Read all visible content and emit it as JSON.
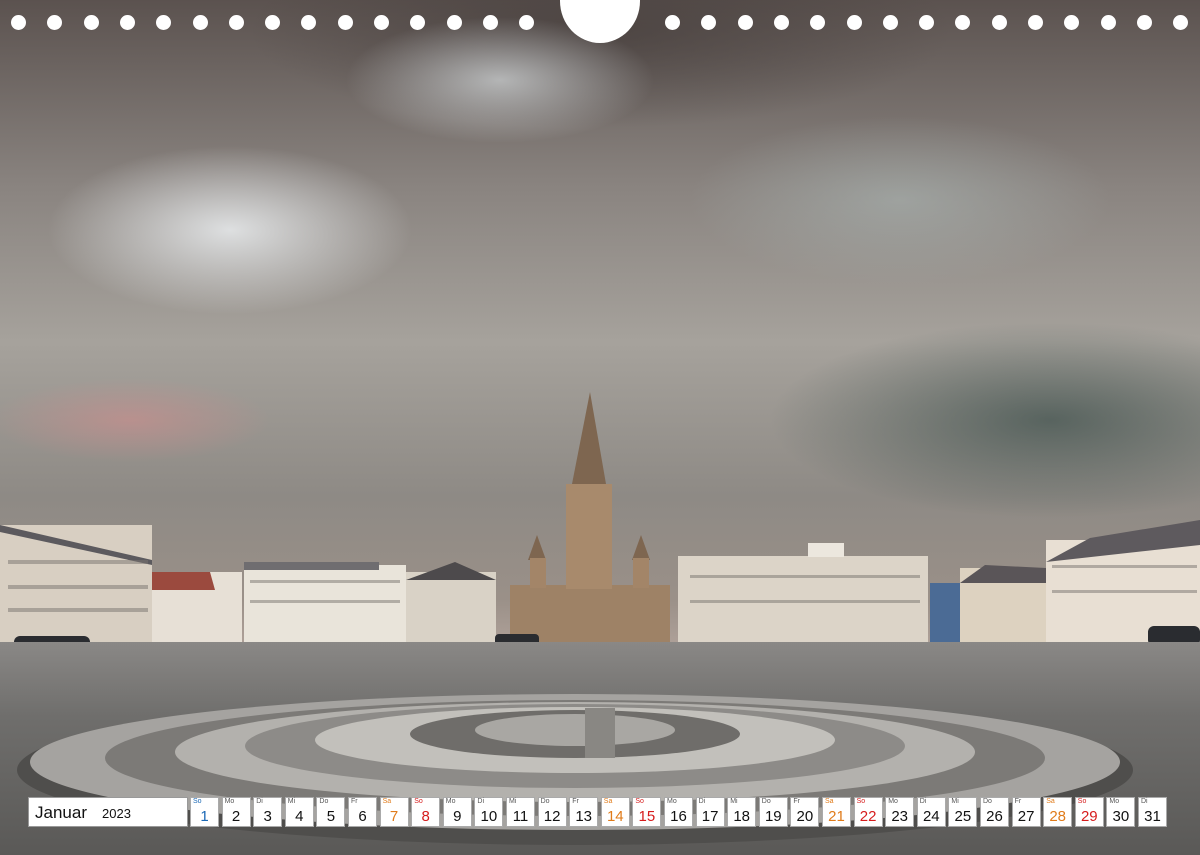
{
  "calendar": {
    "month": "Januar",
    "year": "2023",
    "days": [
      {
        "num": "1",
        "dow": "So",
        "type": "first"
      },
      {
        "num": "2",
        "dow": "Mo",
        "type": "weekday"
      },
      {
        "num": "3",
        "dow": "Di",
        "type": "weekday"
      },
      {
        "num": "4",
        "dow": "Mi",
        "type": "weekday"
      },
      {
        "num": "5",
        "dow": "Do",
        "type": "weekday"
      },
      {
        "num": "6",
        "dow": "Fr",
        "type": "weekday"
      },
      {
        "num": "7",
        "dow": "Sa",
        "type": "sat"
      },
      {
        "num": "8",
        "dow": "So",
        "type": "sun"
      },
      {
        "num": "9",
        "dow": "Mo",
        "type": "weekday"
      },
      {
        "num": "10",
        "dow": "Di",
        "type": "weekday"
      },
      {
        "num": "11",
        "dow": "Mi",
        "type": "weekday"
      },
      {
        "num": "12",
        "dow": "Do",
        "type": "weekday"
      },
      {
        "num": "13",
        "dow": "Fr",
        "type": "weekday"
      },
      {
        "num": "14",
        "dow": "Sa",
        "type": "sat"
      },
      {
        "num": "15",
        "dow": "So",
        "type": "sun"
      },
      {
        "num": "16",
        "dow": "Mo",
        "type": "weekday"
      },
      {
        "num": "17",
        "dow": "Di",
        "type": "weekday"
      },
      {
        "num": "18",
        "dow": "Mi",
        "type": "weekday"
      },
      {
        "num": "19",
        "dow": "Do",
        "type": "weekday"
      },
      {
        "num": "20",
        "dow": "Fr",
        "type": "weekday"
      },
      {
        "num": "21",
        "dow": "Sa",
        "type": "sat"
      },
      {
        "num": "22",
        "dow": "So",
        "type": "sun"
      },
      {
        "num": "23",
        "dow": "Mo",
        "type": "weekday"
      },
      {
        "num": "24",
        "dow": "Di",
        "type": "weekday"
      },
      {
        "num": "25",
        "dow": "Mi",
        "type": "weekday"
      },
      {
        "num": "26",
        "dow": "Do",
        "type": "weekday"
      },
      {
        "num": "27",
        "dow": "Fr",
        "type": "weekday"
      },
      {
        "num": "28",
        "dow": "Sa",
        "type": "sat"
      },
      {
        "num": "29",
        "dow": "So",
        "type": "sun"
      },
      {
        "num": "30",
        "dow": "Mo",
        "type": "weekday"
      },
      {
        "num": "31",
        "dow": "Di",
        "type": "weekday"
      }
    ]
  },
  "colors": {
    "saturday": "#e07b1a",
    "sunday": "#d61c1c",
    "first_day": "#1a68b5"
  }
}
